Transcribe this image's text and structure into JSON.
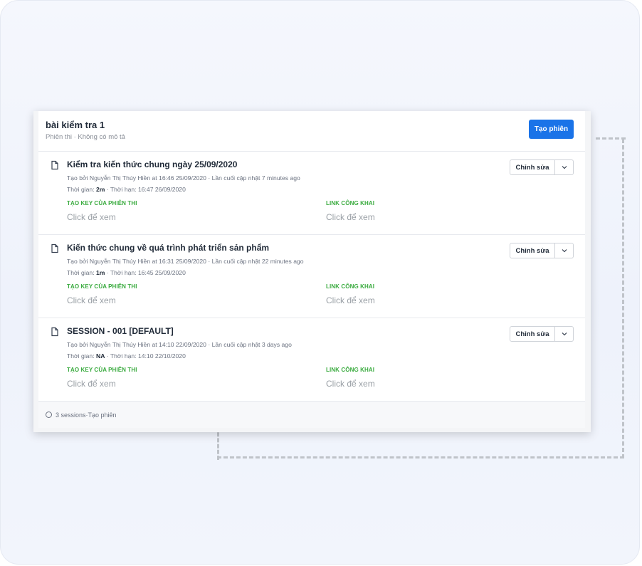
{
  "header": {
    "title": "bài kiểm tra 1",
    "subtitle": "Phiên thi · Không có mô tả",
    "create_button": "Tạo phiên"
  },
  "labels": {
    "key": "TẠO KEY CỦA PHIÊN THI",
    "public_link": "LINK CÔNG KHAI",
    "click_to_view": "Click để xem",
    "edit": "Chỉnh sửa"
  },
  "sessions": [
    {
      "title": "Kiểm tra kiến thức chung ngày 25/09/2020",
      "created": "Tạo bởi Nguyễn Thị Thúy Hiền at 16:46 25/09/2020 · Lần cuối cập nhật 7 minutes ago",
      "time_prefix": "Thời gian: ",
      "duration": "2m",
      "deadline": " · Thời hạn: 16:47 26/09/2020"
    },
    {
      "title": "Kiến thức chung về quá trình phát triển sản phẩm",
      "created": "Tạo bởi Nguyễn Thị Thúy Hiền at 16:31 25/09/2020 · Lần cuối cập nhật 22 minutes ago",
      "time_prefix": "Thời gian: ",
      "duration": "1m",
      "deadline": " · Thời hạn: 16:45 25/09/2020"
    },
    {
      "title": "SESSION - 001 [DEFAULT]",
      "created": "Tạo bởi Nguyễn Thị Thúy Hiền at 14:10 22/09/2020 · Lần cuối cập nhật 3 days ago",
      "time_prefix": "Thời gian: ",
      "duration": "NA",
      "deadline": " · Thời hạn: 14:10 22/10/2020"
    }
  ],
  "footer": {
    "count": "3 sessions",
    "separator": " · ",
    "create_link": "Tạo phiên"
  },
  "colors": {
    "primary": "#1a73e8",
    "label_green": "#3aab3f"
  }
}
